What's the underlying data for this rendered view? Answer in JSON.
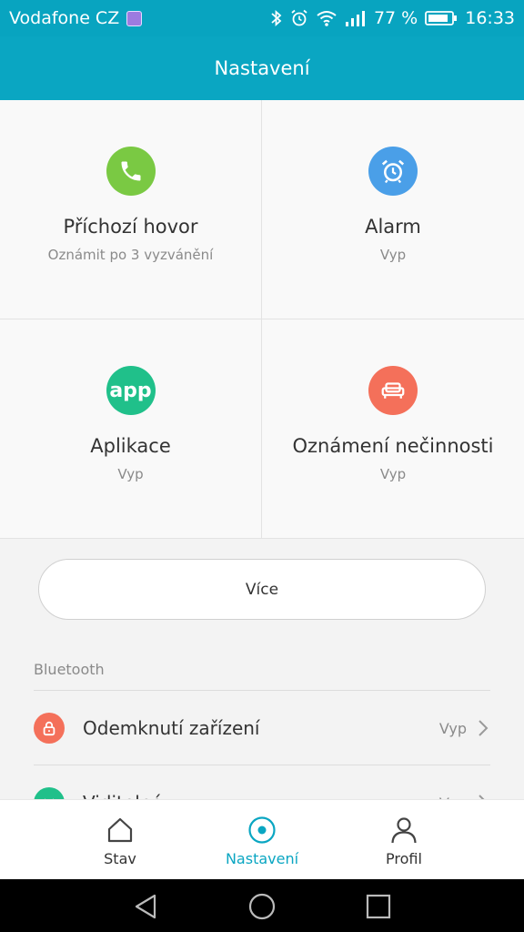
{
  "status_bar": {
    "carrier": "Vodafone CZ",
    "battery_percent": "77 %",
    "time": "16:33",
    "icons": [
      "image-icon",
      "bluetooth-icon",
      "alarm-clock-icon",
      "wifi-icon",
      "signal-icon",
      "battery-icon"
    ]
  },
  "header": {
    "title": "Nastavení"
  },
  "tiles": [
    {
      "title": "Příchozí hovor",
      "subtitle": "Oznámit po 3 vyzvánění",
      "icon": "phone-icon",
      "color": "#7ac943"
    },
    {
      "title": "Alarm",
      "subtitle": "Vyp",
      "icon": "alarm-icon",
      "color": "#4a9fe8"
    },
    {
      "title": "Aplikace",
      "subtitle": "Vyp",
      "icon_text": "app",
      "icon": "app-icon",
      "color": "#20c08a"
    },
    {
      "title": "Oznámení nečinnosti",
      "subtitle": "Vyp",
      "icon": "sofa-icon",
      "color": "#f4705a"
    }
  ],
  "more_button": {
    "label": "Více"
  },
  "bluetooth_section": {
    "label": "Bluetooth",
    "rows": [
      {
        "label": "Odemknutí zařízení",
        "value": "Vyp",
        "icon": "lock-icon",
        "color": "#f4705a"
      },
      {
        "label": "Viditelné",
        "value": "Vyp",
        "icon": "broadcast-icon",
        "color": "#20c08a"
      }
    ]
  },
  "bottom_nav": [
    {
      "label": "Stav",
      "icon": "home-icon",
      "active": false
    },
    {
      "label": "Nastavení",
      "icon": "target-icon",
      "active": true
    },
    {
      "label": "Profil",
      "icon": "person-icon",
      "active": false
    }
  ],
  "colors": {
    "accent": "#0aa6c2",
    "status_bar": "#08a4c0"
  }
}
